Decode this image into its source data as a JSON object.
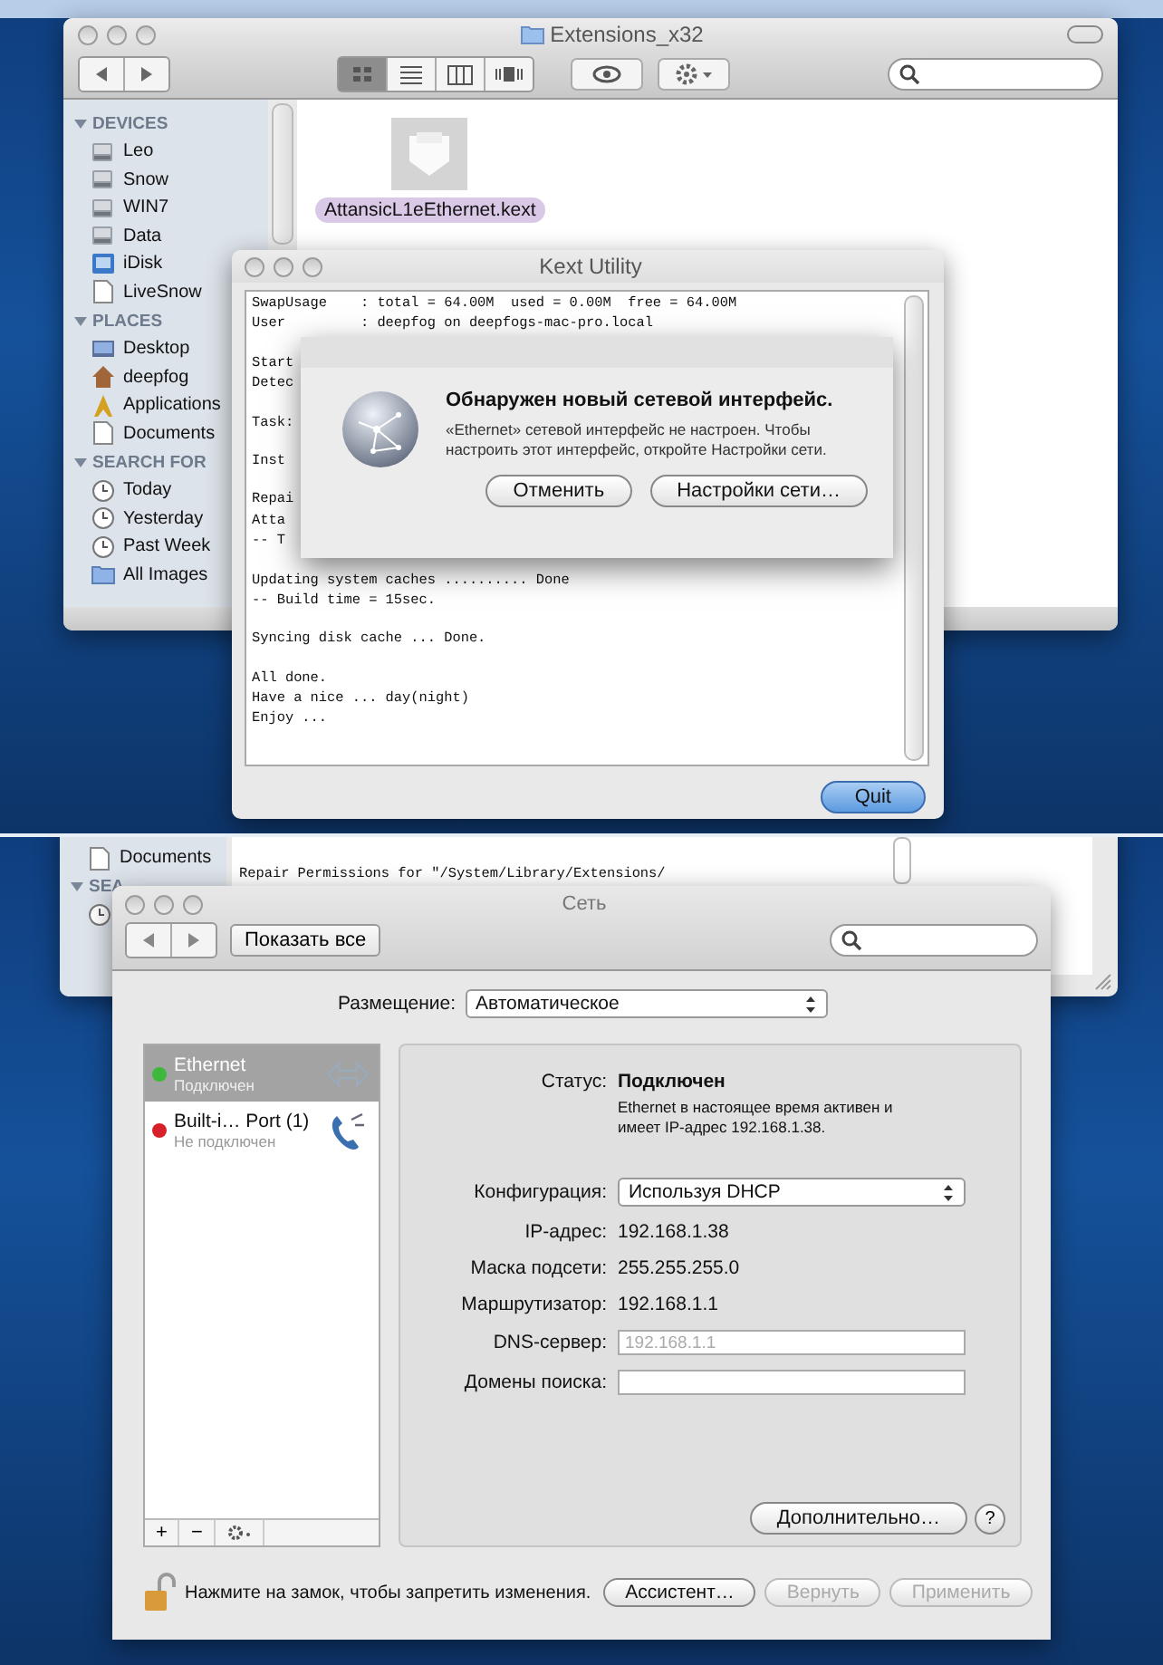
{
  "top_screenshot": {
    "finder": {
      "title": "Extensions_x32",
      "view_modes": [
        {
          "kind": "icon",
          "selected": true
        },
        {
          "kind": "list",
          "selected": false
        },
        {
          "kind": "columns",
          "selected": false
        },
        {
          "kind": "coverflow",
          "selected": false
        }
      ],
      "sidebar": [
        {
          "heading": "DEVICES",
          "expanded": true,
          "items": [
            {
              "label": "Leo",
              "kind": "disk"
            },
            {
              "label": "Snow",
              "kind": "disk"
            },
            {
              "label": "WIN7",
              "kind": "disk"
            },
            {
              "label": "Data",
              "kind": "disk"
            },
            {
              "label": "iDisk",
              "kind": "idisk"
            },
            {
              "label": "LiveSnow",
              "kind": "doc"
            }
          ]
        },
        {
          "heading": "PLACES",
          "expanded": true,
          "items": [
            {
              "label": "Desktop",
              "kind": "desktop"
            },
            {
              "label": "deepfog",
              "kind": "home"
            },
            {
              "label": "Applications",
              "kind": "apps"
            },
            {
              "label": "Documents",
              "kind": "doc"
            }
          ]
        },
        {
          "heading": "SEARCH FOR",
          "expanded": true,
          "items": [
            {
              "label": "Today",
              "kind": "clock"
            },
            {
              "label": "Yesterday",
              "kind": "clock"
            },
            {
              "label": "Past Week",
              "kind": "clock"
            },
            {
              "label": "All Images",
              "kind": "folder"
            }
          ]
        }
      ],
      "files": [
        {
          "name": "AttansicL1eEthernet.kext",
          "selected": true
        }
      ]
    },
    "kext_utility": {
      "title": "Kext Utility",
      "log": [
        [
          "SwapUsage    : total = 64.00M  used = 0.00M  free = 64.00M",
          "User         : deepfog on deepfogs-mac-pro.local"
        ],
        [
          "Start",
          "Detec"
        ],
        [
          "Task:"
        ],
        [
          "Inst"
        ],
        [
          "Repai",
          "Atta",
          "-- T"
        ],
        [
          "Updating system caches .......... Done",
          "-- Build time = 15sec."
        ],
        [
          "Syncing disk cache ... Done."
        ],
        [
          "All done.",
          "Have a nice ... day(night)",
          "Enjoy ..."
        ]
      ],
      "buttons": [
        {
          "label": "Quit",
          "default": true
        }
      ]
    },
    "alert": {
      "title": "Обнаружен новый сетевой интерфейс.",
      "message": "«Ethernet» сетевой интерфейс не настроен. Чтобы настроить этот интерфейс, откройте Настройки сети.",
      "buttons": [
        {
          "label": "Отменить",
          "default": false
        },
        {
          "label": "Настройки сети…",
          "default": false
        }
      ]
    }
  },
  "bottom_screenshot": {
    "finder": {
      "sidebar_items": [
        {
          "label": "Documents",
          "kind": "doc"
        }
      ],
      "section_heading": "SEA",
      "log_line": "Repair Permissions for \"/System/Library/Extensions/"
    },
    "network": {
      "title": "Сеть",
      "show_all": "Показать все",
      "location_label": "Размещение:",
      "location": "Автоматическое",
      "services": [
        {
          "name": "Ethernet",
          "status": "Подключен",
          "color": "#3cb83c",
          "selected": true,
          "kind": "ethernet"
        },
        {
          "name": "Built-i… Port (1)",
          "status": "Не подключен",
          "color": "#d8202a",
          "selected": false,
          "kind": "phone"
        }
      ],
      "status_label": "Статус:",
      "status": "Подключен",
      "status_note": "Ethernet в настоящее время активен и имеет IP-адрес 192.168.1.38.",
      "fields": [
        {
          "kind": "popup",
          "label": "Конфигурация:",
          "value": "Используя DHCP"
        },
        {
          "kind": "text",
          "label": "IP-адрес:",
          "value": "192.168.1.38"
        },
        {
          "kind": "text",
          "label": "Маска подсети:",
          "value": "255.255.255.0"
        },
        {
          "kind": "text",
          "label": "Маршрутизатор:",
          "value": "192.168.1.1"
        },
        {
          "kind": "input",
          "label": "DNS-сервер:",
          "placeholder": "192.168.1.1"
        },
        {
          "kind": "input",
          "label": "Домены поиска:"
        }
      ],
      "list_buttons": [
        "+",
        "−"
      ],
      "advanced_button": "Дополнительно…",
      "help_button": "?",
      "lock_note": "Нажмите на замок, чтобы запретить изменения.",
      "buttons": [
        {
          "label": "Ассистент…",
          "disabled": false
        },
        {
          "label": "Вернуть",
          "disabled": true
        },
        {
          "label": "Применить",
          "disabled": true
        }
      ]
    }
  }
}
